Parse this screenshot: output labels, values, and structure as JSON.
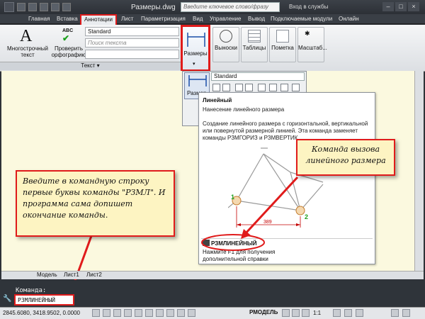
{
  "app": {
    "document_title": "Размеры.dwg",
    "search_placeholder": "Введите ключевое слово/фразу",
    "signin_label": "Вход в службы"
  },
  "tabs": [
    "Главная",
    "Вставка",
    "Аннотации",
    "Лист",
    "Параметризация",
    "Вид",
    "Управление",
    "Вывод",
    "Подключаемые модули",
    "Онлайн"
  ],
  "active_tab": "Аннотации",
  "ribbon": {
    "mtext_label": "Многострочный текст",
    "spell_label": "Проверить орфографию",
    "style_combo": "Standard",
    "text_search_placeholder": "Поиск текста",
    "text_panel_label": "Текст",
    "dimensions_label": "Размеры",
    "leaders_label": "Выноски",
    "tables_label": "Таблицы",
    "markup_label": "Пометка",
    "scale_label": "Масштаб..."
  },
  "dim_dropdown": {
    "style_combo": "Standard",
    "linear_label": "Размер"
  },
  "tooltip": {
    "title": "Линейный",
    "subtitle": "Нанесение линейного размера",
    "description": "Создание линейного размера с горизонтальной, вертикальной или повернутой размерной линией. Эта команда заменяет команды РЗМГОРИЗ и РЗМВЕРТИК.",
    "dimension_value": "389",
    "point1": "1",
    "point2": "2",
    "command_name": "РЗМЛИНЕЙНЫЙ",
    "help_hint": "Нажмите F1 для получения дополнительной справки"
  },
  "callouts": {
    "right": "Команда вызова линейного размера",
    "left": "Введите в командную строку первые буквы команды \"РЗМЛ\". И программа сама допишет окончание команды."
  },
  "sheet_tabs": [
    "Модель",
    "Лист1",
    "Лист2"
  ],
  "command": {
    "prompt": "Команда:",
    "input": "РЗМЛИНЕЙНЫЙ"
  },
  "status": {
    "coordinates": "2845.6080, 3418.9502, 0.0000",
    "model": "РМОДЕЛЬ",
    "scale": "1:1"
  },
  "colors": {
    "highlight_red": "#e01b1b",
    "callout_bg": "#fdf4c2",
    "canvas_bg": "#fbf9df",
    "point_green": "#1ca01c"
  }
}
